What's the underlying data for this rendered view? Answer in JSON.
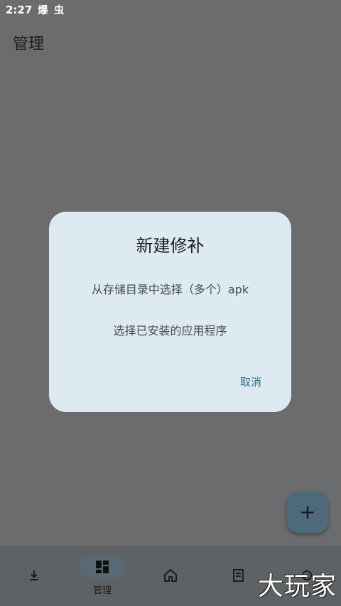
{
  "status_bar": {
    "time": "2:27",
    "icons_text": "爆 虫"
  },
  "app_bar": {
    "title": "管理"
  },
  "dialog": {
    "title": "新建修补",
    "option_from_storage": "从存储目录中选择（多个）apk",
    "option_installed": "选择已安装的应用程序",
    "cancel_label": "取消"
  },
  "fab": {
    "icon": "add-icon",
    "glyph": "+"
  },
  "bottom_nav": {
    "items": [
      {
        "icon": "download-icon",
        "label": ""
      },
      {
        "icon": "dashboard-icon",
        "label": "管理"
      },
      {
        "icon": "home-icon",
        "label": ""
      },
      {
        "icon": "document-icon",
        "label": ""
      },
      {
        "icon": "settings-icon",
        "label": ""
      }
    ]
  },
  "watermark": {
    "text": "大玩家"
  },
  "colors": {
    "scrim_background": "#6b6c6e",
    "dialog_background": "#deeaf2",
    "accent": "#2c6b86",
    "fab": "#4e6a7a",
    "nav_background": "#5f6264"
  }
}
